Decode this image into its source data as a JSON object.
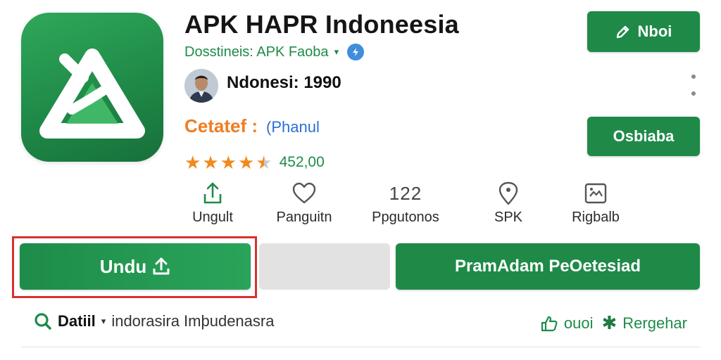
{
  "app": {
    "title": "APK HAPR Indoneesia",
    "developer": "Dosstineis: APK Faoba",
    "developer_caret": "▾",
    "user_line": "Ndonesi: 1990",
    "category_label": "Cetatef :",
    "category_value": "(Phanul",
    "rating_text": "452,00",
    "stars_value": 4.5,
    "stars_max": 5
  },
  "buttons": {
    "top_right": "Nboi",
    "mid_right": "Osbiaba",
    "download": "Undu",
    "wide": "PramAdam PeOetesiad"
  },
  "actions": [
    {
      "label": "Ungult",
      "icon": "share-icon"
    },
    {
      "label": "Panguitn",
      "icon": "heart-icon"
    },
    {
      "label": "Ppgutonos",
      "icon": "counter-icon",
      "value": "122"
    },
    {
      "label": "SPK",
      "icon": "location-pin-icon"
    },
    {
      "label": "Rigbalb",
      "icon": "screenshot-icon"
    }
  ],
  "detail": {
    "label": "Datiil",
    "caret": "▾",
    "text": "indorasira Imþudenasra"
  },
  "right_links": {
    "t1": "ouoi",
    "t2": "Rergehar"
  },
  "colors": {
    "brand_green": "#1f8a48",
    "accent_orange": "#ef7d22",
    "link_blue": "#2b6fd6",
    "highlight_red": "#d8312f"
  }
}
